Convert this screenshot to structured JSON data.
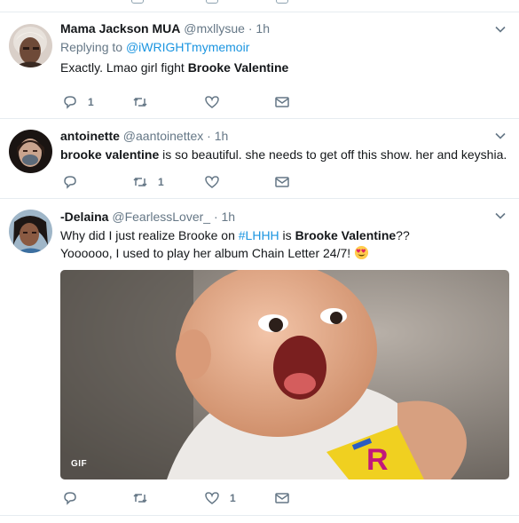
{
  "tweets": [
    {
      "name": "Mama Jackson MUA",
      "handle": "@mxllysue",
      "dot": "·",
      "time": "1h",
      "reply_prefix": "Replying to",
      "reply_handle": "@iWRIGHTmymemoir",
      "text_plain": "Exactly. Lmao girl fight ",
      "text_bold": "Brooke Valentine",
      "reply_count": "1",
      "retweet_count": "",
      "like_count": ""
    },
    {
      "name": "antoinette",
      "handle": "@aantoinettex",
      "dot": "·",
      "time": "1h",
      "text_bold": "brooke valentine",
      "text_plain": " is so beautiful. she needs to get off this show. her and keyshia.",
      "reply_count": "",
      "retweet_count": "1",
      "like_count": ""
    },
    {
      "name": "-Delaina",
      "handle": "@FearlessLover_",
      "dot": "·",
      "time": "1h",
      "line1_a": "Why did I just realize Brooke on ",
      "line1_hashtag": "#LHHH",
      "line1_b": " is ",
      "line1_bold": "Brooke Valentine",
      "line1_c": "??",
      "line2": "Yoooooo, I used to play her album Chain Letter 24/7! ",
      "media_badge": "GIF",
      "reply_count": "",
      "retweet_count": "",
      "like_count": "1"
    }
  ],
  "icons": {
    "reply": "reply-icon",
    "retweet": "retweet-icon",
    "like": "heart-icon",
    "dm": "envelope-icon",
    "more": "chevron-down-icon",
    "emoji": "heart-eyes-emoji-icon"
  },
  "colors": {
    "link": "#1b95e0",
    "secondary": "#657786",
    "icon": "#657786",
    "divider": "#e6ecf0"
  }
}
